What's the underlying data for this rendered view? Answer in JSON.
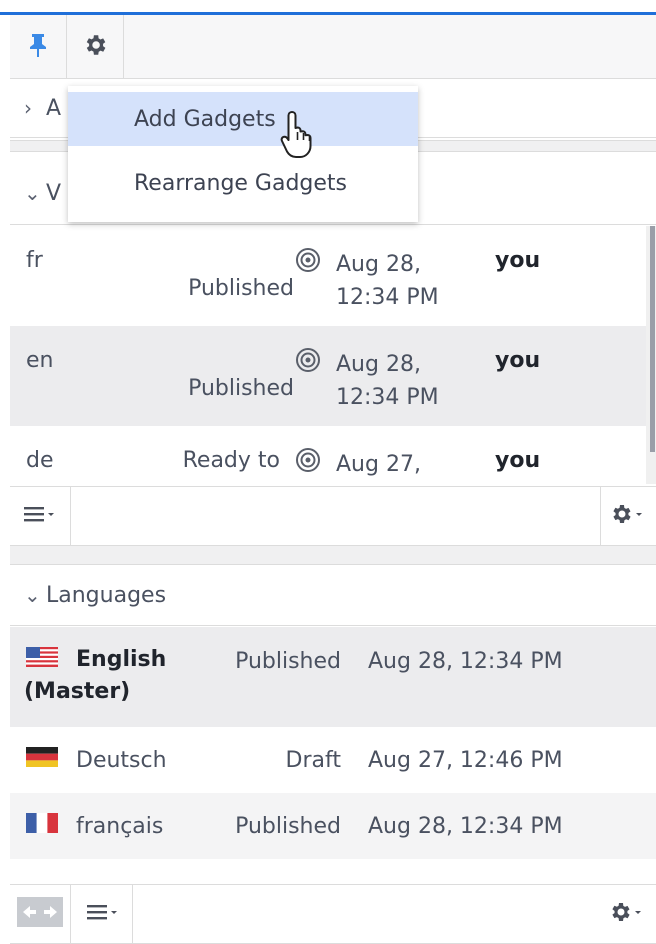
{
  "toolbar": {
    "pin_icon": "pin-icon",
    "settings_icon": "gear-icon"
  },
  "panels": {
    "first": {
      "header_partial": "A"
    },
    "second": {
      "header_partial": "V"
    }
  },
  "dropdown": {
    "items": [
      {
        "label": "Add Gadgets",
        "active": true
      },
      {
        "label": "Rearrange Gadgets",
        "active": false
      }
    ]
  },
  "versions": {
    "rows": [
      {
        "locale": "fr",
        "state": "Published",
        "date_line1": "Aug 28,",
        "date_line2": "12:34 PM",
        "user": "you"
      },
      {
        "locale": "en",
        "state": "Published",
        "date_line1": "Aug 28,",
        "date_line2": "12:34 PM",
        "user": "you"
      },
      {
        "locale": "de",
        "state": "Ready to",
        "date_line1": "Aug 27,",
        "date_line2": "",
        "user": "you"
      }
    ]
  },
  "languages": {
    "title": "Languages",
    "rows": [
      {
        "name": "English",
        "name2": "(Master)",
        "state": "Published",
        "date": "Aug 28, 12:34 PM",
        "flag": "us-flag-icon"
      },
      {
        "name": "Deutsch",
        "state": "Draft",
        "date": "Aug 27, 12:46 PM",
        "flag": "de-flag-icon"
      },
      {
        "name": "français",
        "state": "Published",
        "date": "Aug 28, 12:34 PM",
        "flag": "fr-flag-icon"
      }
    ]
  },
  "colors": {
    "accent": "#1f6fd9",
    "dropdown_active": "#d5e2fb",
    "selected_row": "#ececee"
  }
}
